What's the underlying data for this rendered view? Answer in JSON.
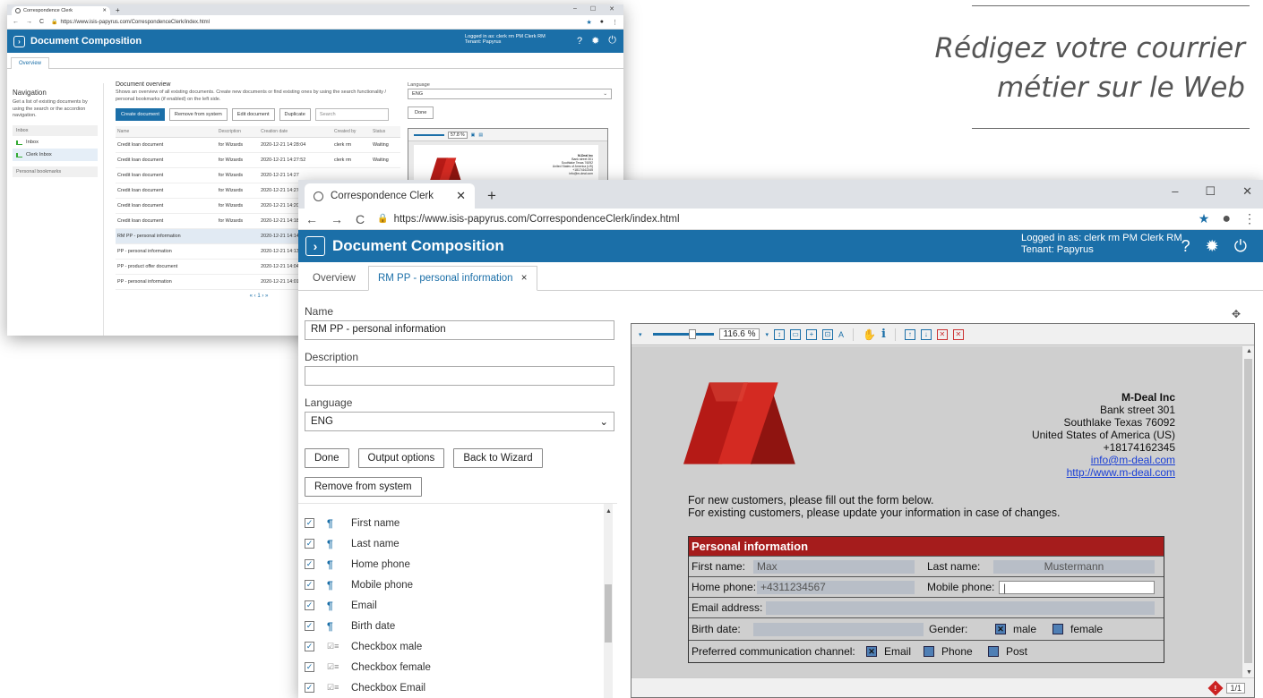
{
  "tagline": {
    "line1": "Rédigez votre courrier",
    "line2": "métier sur le Web"
  },
  "back_window": {
    "browser_tab": "Correspondence Clerk",
    "url": "https://www.isis-papyrus.com/CorrespondenceClerk/index.html",
    "app_title": "Document Composition",
    "login_line1": "Logged in as: clerk rm PM Clerk RM",
    "login_line2": "Tenant: Papyrus",
    "subtab": "Overview",
    "nav": {
      "title": "Navigation",
      "description": "Get a list of existing documents by using the search or the accordion navigation.",
      "group": "Inbox",
      "items": [
        "Inbox",
        "Clerk Inbox"
      ],
      "bookmarks": "Personal bookmarks"
    },
    "overview_title": "Document overview",
    "overview_desc": "Shows an overview of all existing documents. Create new documents or find existing ones by using the search functionality / personal bookmarks (if enabled) on the left side.",
    "buttons": [
      "Create document",
      "Remove from system",
      "Edit document",
      "Duplicate"
    ],
    "search_placeholder": "Search",
    "table": {
      "headers": [
        "Name",
        "Description",
        "Creation date",
        "Created by",
        "Status"
      ],
      "rows": [
        [
          "Credit loan document",
          "for Wizards",
          "2020-12-21 14:28:04",
          "clerk rm",
          "Waiting"
        ],
        [
          "Credit loan document",
          "for Wizards",
          "2020-12-21 14:27:52",
          "clerk rm",
          "Waiting"
        ],
        [
          "Credit loan document",
          "for Wizards",
          "2020-12-21 14:27",
          "",
          ""
        ],
        [
          "Credit loan document",
          "for Wizards",
          "2020-12-21 14:27",
          "",
          ""
        ],
        [
          "Credit loan document",
          "for Wizards",
          "2020-12-21 14:20",
          "",
          ""
        ],
        [
          "Credit loan document",
          "for Wizards",
          "2020-12-21 14:18",
          "",
          ""
        ],
        [
          "RM PP - personal information",
          "",
          "2020-12-21 14:14",
          "",
          ""
        ],
        [
          "PP - personal information",
          "",
          "2020-12-21 14:13",
          "",
          ""
        ],
        [
          "PP - product offer document",
          "",
          "2020-12-21 14:04",
          "",
          ""
        ],
        [
          "PP - personal information",
          "",
          "2020-12-21 14:01",
          "",
          ""
        ]
      ]
    },
    "pager": "« ‹ 1 › »",
    "language_label": "Language",
    "language_value": "ENG",
    "done": "Done",
    "zoom": "57.8 %",
    "company_lines": [
      "M-Deal Inc",
      "Bank street 301",
      "Southlake Texas 76092",
      "United States of America (US)",
      "+18174162345",
      "info@m-deal.com"
    ]
  },
  "front_window": {
    "browser_tab": "Correspondence Clerk",
    "url": "https://www.isis-papyrus.com/CorrespondenceClerk/index.html",
    "app_title": "Document Composition",
    "login_line1": "Logged in as: clerk rm PM Clerk RM",
    "login_line2": "Tenant: Papyrus",
    "tabs": [
      "Overview",
      "RM PP - personal information"
    ],
    "form": {
      "name_label": "Name",
      "name_value": "RM  PP - personal information",
      "desc_label": "Description",
      "desc_value": "",
      "lang_label": "Language",
      "lang_value": "ENG",
      "btn_done": "Done",
      "btn_output": "Output options",
      "btn_back": "Back to Wizard",
      "btn_remove": "Remove from system"
    },
    "checklist": [
      "First name",
      "Last name",
      "Home phone",
      "Mobile phone",
      "Email",
      "Birth date",
      "Checkbox male",
      "Checkbox female",
      "Checkbox Email"
    ],
    "viewer": {
      "zoom": "116.6 %",
      "page": "1/1",
      "company": {
        "name": "M-Deal Inc",
        "street": "Bank street 301",
        "city": "Southlake Texas 76092",
        "country": "United States of America (US)",
        "phone": "+18174162345",
        "email": "info@m-deal.com",
        "web": "http://www.m-deal.com"
      },
      "intro1": "For new customers, please fill out the form below.",
      "intro2": "For existing customers, please update your information in case of changes.",
      "section_title": "Personal information",
      "first_name_label": "First name:",
      "first_name_value": "Max",
      "last_name_label": "Last name:",
      "last_name_value": "Mustermann",
      "home_phone_label": "Home phone:",
      "home_phone_value": "+4311234567",
      "mobile_label": "Mobile phone:",
      "email_label": "Email address:",
      "birth_label": "Birth date:",
      "gender_label": "Gender:",
      "male": "male",
      "female": "female",
      "channel_label": "Preferred communication channel:",
      "ch_email": "Email",
      "ch_phone": "Phone",
      "ch_post": "Post"
    }
  },
  "colors": {
    "appbar": "#1b6fa8",
    "form_header": "#a51c1c",
    "logo_red": "#c0201b"
  }
}
